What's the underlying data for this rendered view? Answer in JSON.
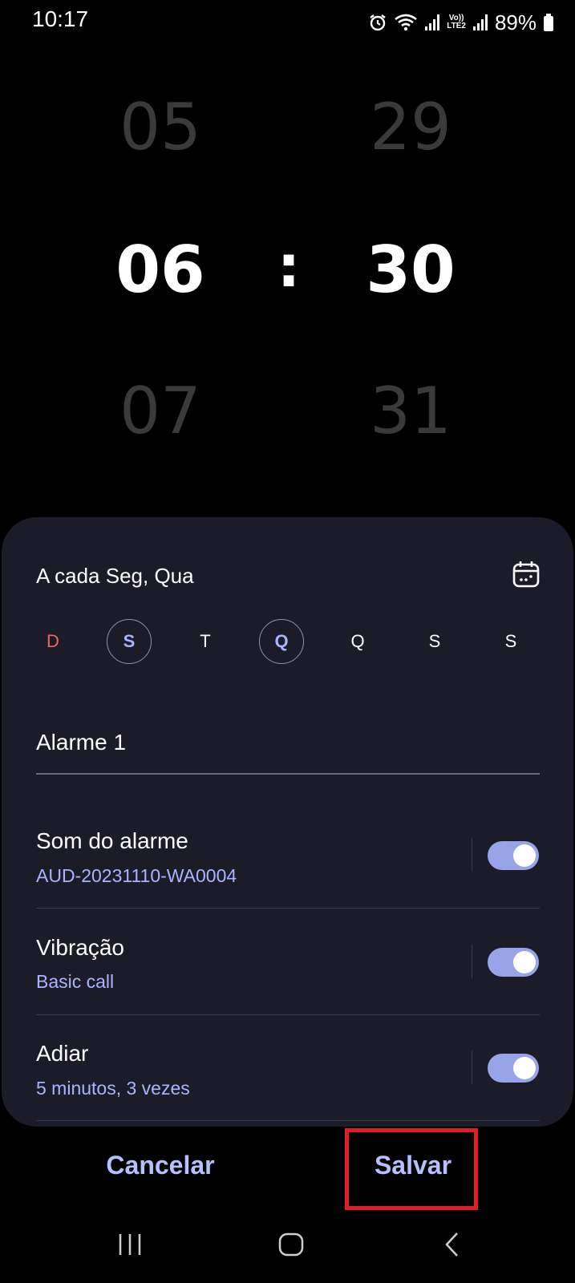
{
  "status_bar": {
    "time": "10:17",
    "network_label_top": "Vo))",
    "network_label_bottom": "LTE2",
    "battery": "89%"
  },
  "time_picker": {
    "hour_prev": "05",
    "hour": "06",
    "hour_next": "07",
    "separator": ":",
    "minute_prev": "29",
    "minute": "30",
    "minute_next": "31"
  },
  "repeat": {
    "label": "A cada Seg, Qua"
  },
  "days": [
    {
      "label": "D",
      "selected": false
    },
    {
      "label": "S",
      "selected": true
    },
    {
      "label": "T",
      "selected": false
    },
    {
      "label": "Q",
      "selected": true
    },
    {
      "label": "Q",
      "selected": false
    },
    {
      "label": "S",
      "selected": false
    },
    {
      "label": "S",
      "selected": false
    }
  ],
  "alarm_name": "Alarme 1",
  "settings": [
    {
      "title": "Som do alarme",
      "subtitle": "AUD-20231110-WA0004",
      "enabled": true
    },
    {
      "title": "Vibração",
      "subtitle": "Basic call",
      "enabled": true
    },
    {
      "title": "Adiar",
      "subtitle": "5 minutos, 3 vezes",
      "enabled": true
    }
  ],
  "actions": {
    "cancel": "Cancelar",
    "save": "Salvar"
  },
  "colors": {
    "accent": "#b7c0ff",
    "toggle_on": "#97a4e8",
    "card_bg": "#1b1c28",
    "sunday": "#e86a5e",
    "highlight": "#e01e2a"
  },
  "icons": [
    "alarm-icon",
    "wifi-icon",
    "signal-icon",
    "battery-icon",
    "calendar-icon",
    "recents-icon",
    "home-icon",
    "back-icon"
  ]
}
